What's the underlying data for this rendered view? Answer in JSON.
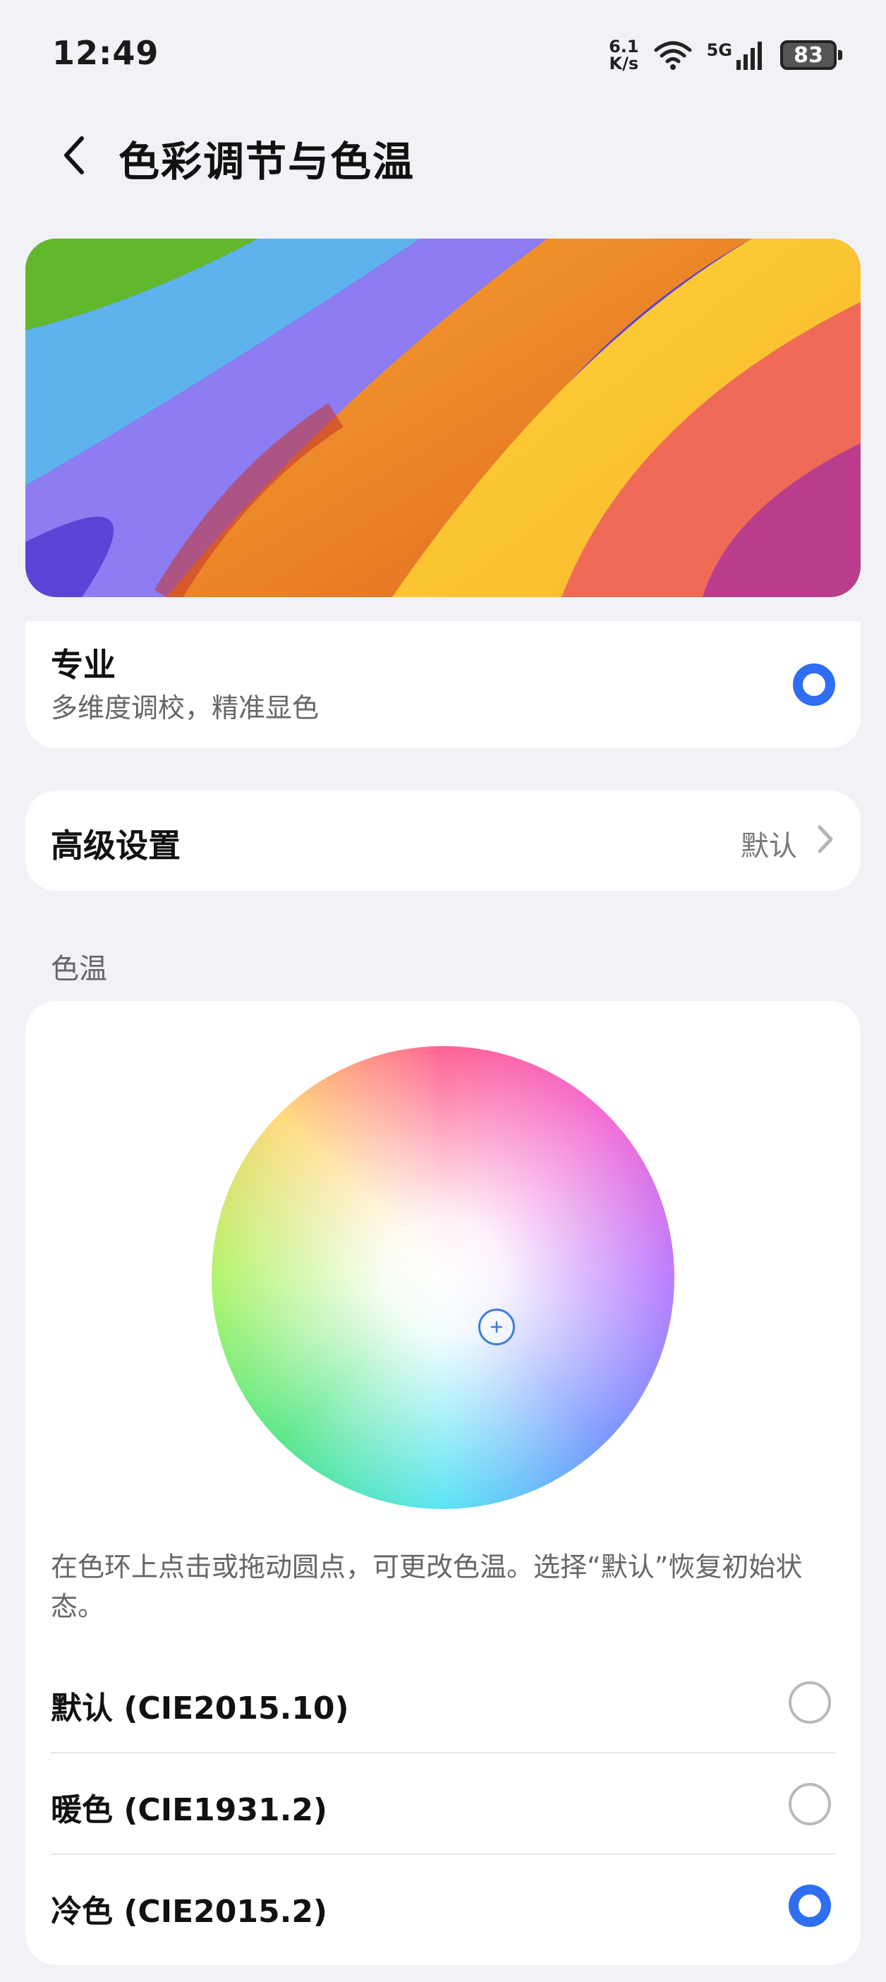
{
  "status_bar": {
    "time": "12:49",
    "net_speed_value": "6.1",
    "net_speed_unit": "K/s",
    "network_type": "5G",
    "battery": "83"
  },
  "header": {
    "title": "色彩调节与色温"
  },
  "profile": {
    "title": "专业",
    "subtitle": "多维度调校，精准显色",
    "selected": true
  },
  "advanced": {
    "label": "高级设置",
    "value": "默认"
  },
  "color_temp": {
    "section_label": "色温",
    "hint": "在色环上点击或拖动圆点，可更改色温。选择“默认”恢复初始状态。",
    "options": [
      {
        "label": "默认 (CIE2015.10)",
        "selected": false
      },
      {
        "label": "暖色 (CIE1931.2)",
        "selected": false
      },
      {
        "label": "冷色 (CIE2015.2)",
        "selected": true
      }
    ]
  },
  "colors": {
    "accent": "#2f6ef3",
    "background": "#f1f2f6",
    "card": "#ffffff"
  },
  "icons": [
    "back-arrow-icon",
    "wifi-icon",
    "signal-icon",
    "battery-icon",
    "chevron-right-icon",
    "crosshair-icon"
  ]
}
